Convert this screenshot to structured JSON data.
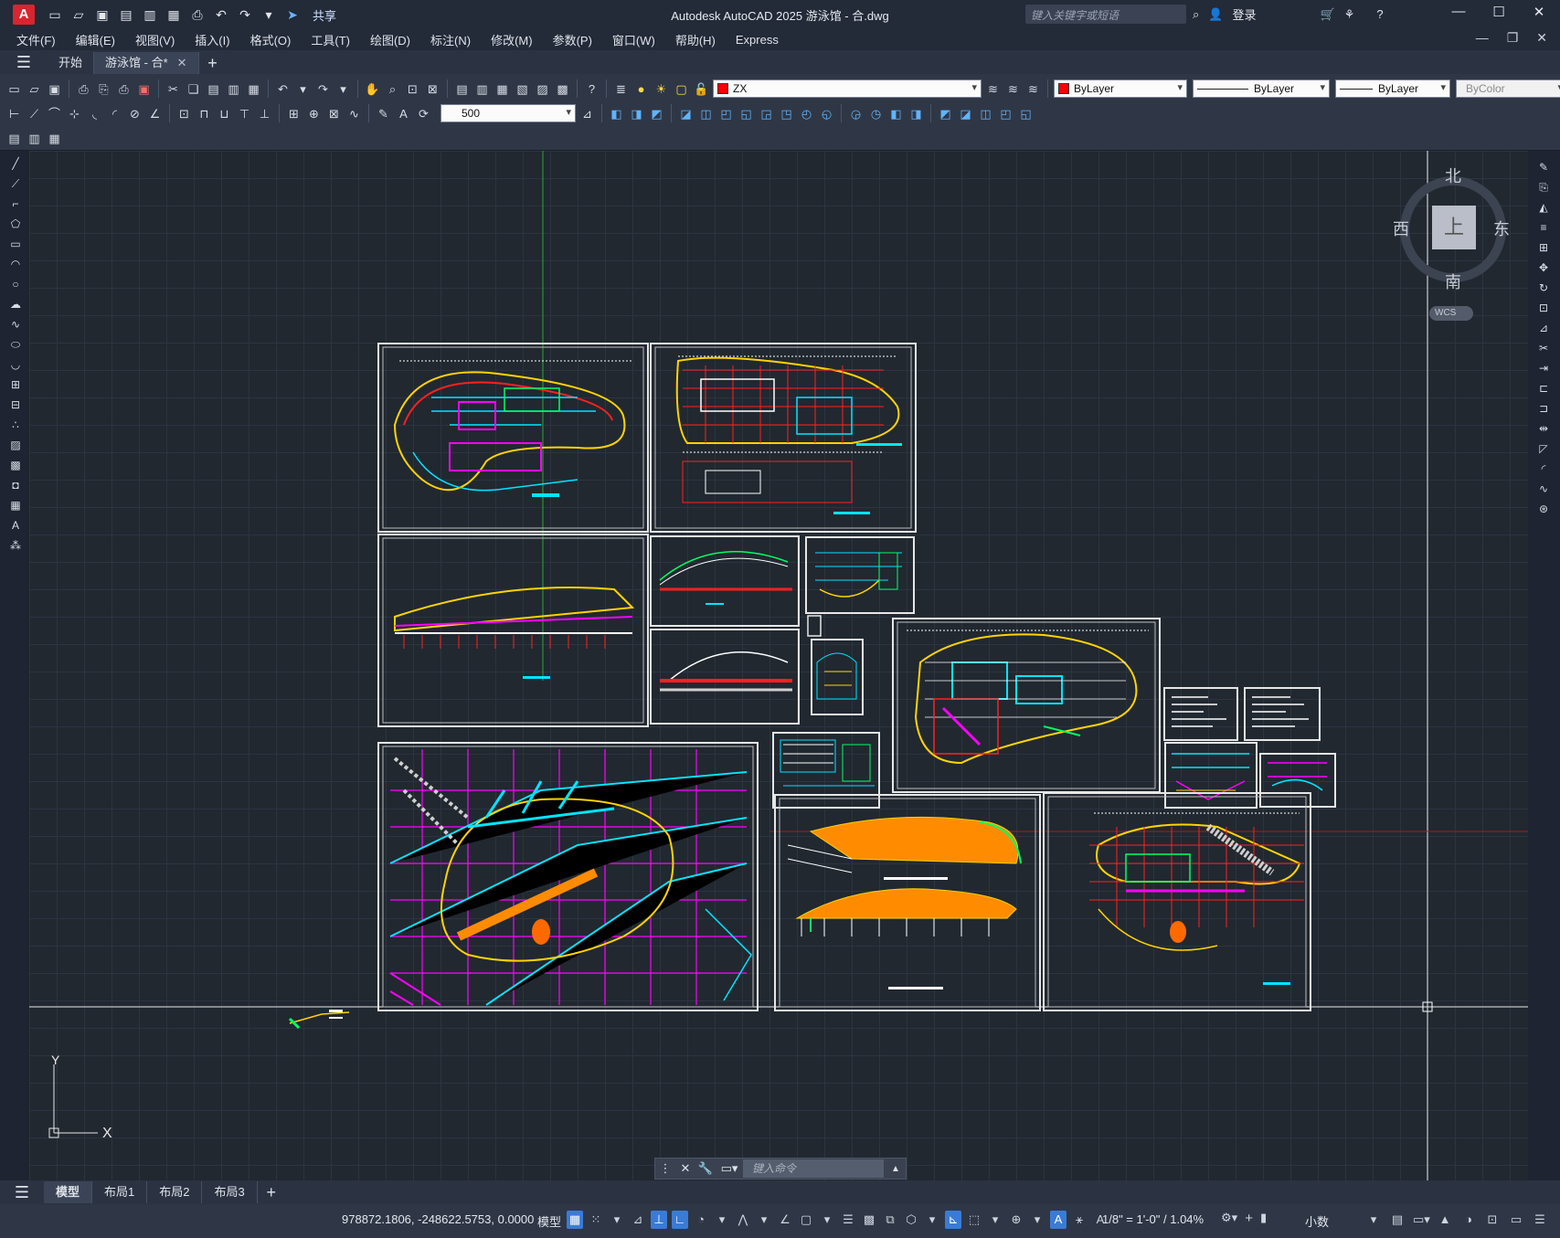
{
  "app": {
    "logo": "A",
    "window_title": "Autodesk AutoCAD 2025    游泳馆 - 合.dwg",
    "share_label": "共享",
    "search_placeholder": "键入关键字或短语",
    "login_label": "登录"
  },
  "menu": [
    "文件(F)",
    "编辑(E)",
    "视图(V)",
    "插入(I)",
    "格式(O)",
    "工具(T)",
    "绘图(D)",
    "标注(N)",
    "修改(M)",
    "参数(P)",
    "窗口(W)",
    "帮助(H)",
    "Express"
  ],
  "file_tabs": [
    {
      "label": "开始",
      "active": false
    },
    {
      "label": "游泳馆 - 合*",
      "active": true
    }
  ],
  "layer_combo": {
    "value": "ZX",
    "color": "#ff0000"
  },
  "color_combo": {
    "value": "ByLayer",
    "color": "#ff0000"
  },
  "linetype_combo": {
    "value": "ByLayer"
  },
  "lineweight_combo": {
    "value": "ByLayer"
  },
  "plotstyle_combo": {
    "value": "ByColor"
  },
  "dimscale_combo": {
    "value": "500"
  },
  "viewcube": {
    "north": "北",
    "south": "南",
    "east": "东",
    "west": "西",
    "face": "上",
    "wcs": "WCS"
  },
  "ucs": {
    "y": "Y",
    "x": "X"
  },
  "command": {
    "placeholder": "键入命令"
  },
  "layout_tabs": [
    {
      "label": "模型",
      "active": true
    },
    {
      "label": "布局1",
      "active": false
    },
    {
      "label": "布局2",
      "active": false
    },
    {
      "label": "布局3",
      "active": false
    }
  ],
  "status": {
    "coordinates": "978872.1806, -248622.5753, 0.0000",
    "space": "模型",
    "annotation_scale": "1/8\" = 1'-0\" / 1.04%",
    "units": "小数"
  }
}
